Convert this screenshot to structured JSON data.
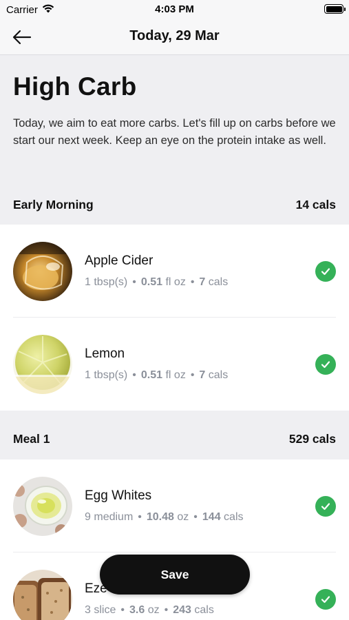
{
  "status_bar": {
    "carrier": "Carrier",
    "time": "4:03 PM"
  },
  "nav": {
    "title": "Today, 29 Mar",
    "back_icon": "arrow-left-icon"
  },
  "intro": {
    "title": "High Carb",
    "description": "Today, we aim to eat more carbs. Let's fill up on carbs before we start our next week. Keep an eye on the protein intake as well."
  },
  "sections": [
    {
      "name": "Early Morning",
      "cals": "14 cals",
      "items": [
        {
          "name": "Apple Cider",
          "qty": "1",
          "unit": "tbsp(s)",
          "weight_val": "0.51",
          "weight_unit": "fl oz",
          "cal_val": "7",
          "cal_unit": "cals",
          "checked": true
        },
        {
          "name": "Lemon",
          "qty": "1",
          "unit": "tbsp(s)",
          "weight_val": "0.51",
          "weight_unit": "fl oz",
          "cal_val": "7",
          "cal_unit": "cals",
          "checked": true
        }
      ]
    },
    {
      "name": "Meal 1",
      "cals": "529 cals",
      "items": [
        {
          "name": "Egg Whites",
          "qty": "9",
          "unit": "medium",
          "weight_val": "10.48",
          "weight_unit": "oz",
          "cal_val": "144",
          "cal_unit": "cals",
          "checked": true
        },
        {
          "name": "Eze",
          "qty": "3",
          "unit": "slice",
          "weight_val": "3.6",
          "weight_unit": "oz",
          "cal_val": "243",
          "cal_unit": "cals",
          "checked": true
        }
      ]
    }
  ],
  "save_label": "Save",
  "colors": {
    "accent_green": "#35b158",
    "button_dark": "#111111",
    "meta_gray": "#8a8f99"
  }
}
